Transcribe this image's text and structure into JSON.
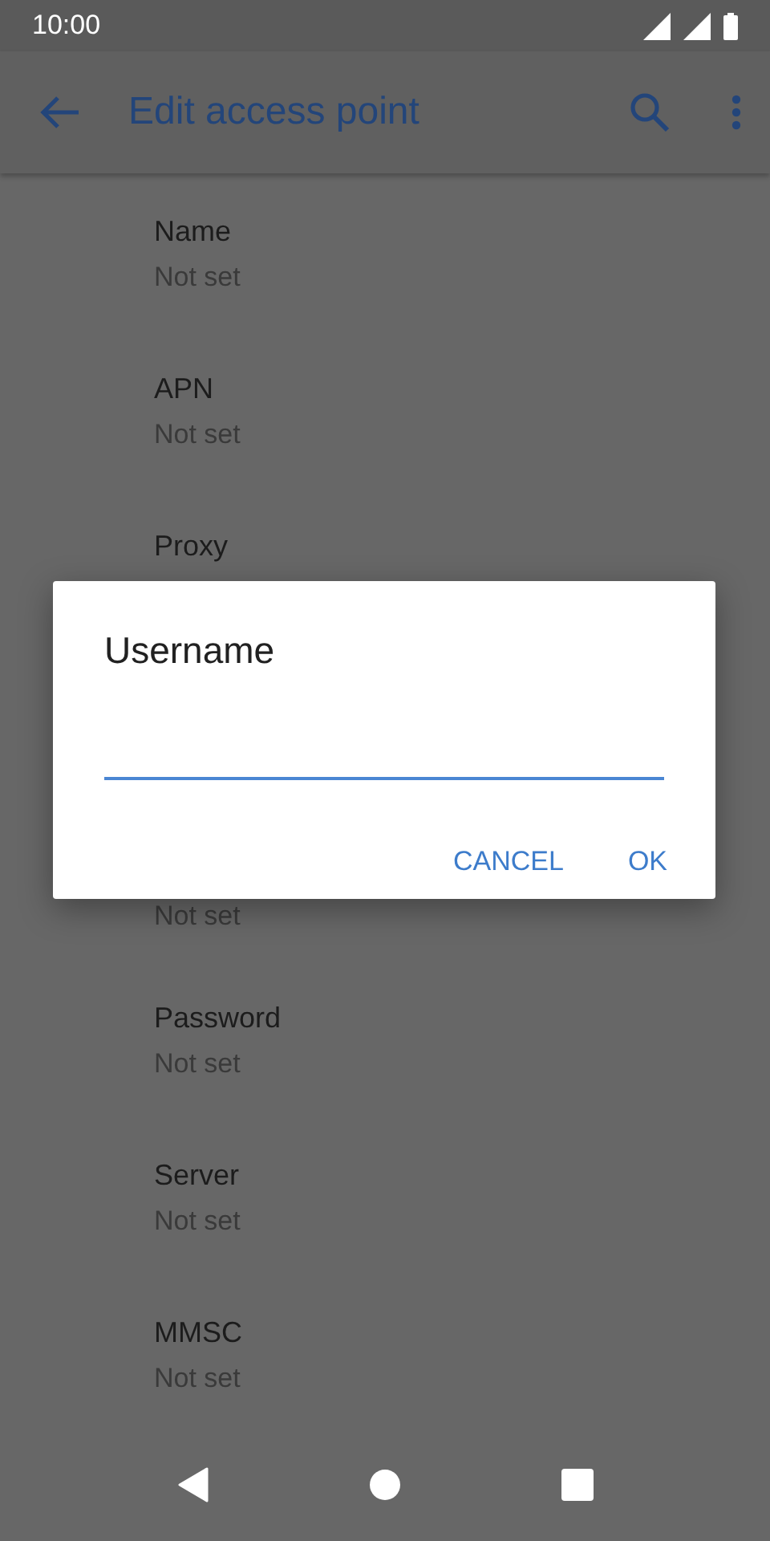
{
  "status_bar": {
    "time": "10:00"
  },
  "app_bar": {
    "title": "Edit access point"
  },
  "settings": [
    {
      "title": "Name",
      "summary": "Not set"
    },
    {
      "title": "APN",
      "summary": "Not set"
    },
    {
      "title": "Proxy"
    },
    {
      "summary": "Not set"
    },
    {
      "title": "Password",
      "summary": "Not set"
    },
    {
      "title": "Server",
      "summary": "Not set"
    },
    {
      "title": "MMSC",
      "summary": "Not set"
    }
  ],
  "dialog": {
    "title": "Username",
    "buttons": [
      "CANCEL",
      "OK"
    ]
  }
}
